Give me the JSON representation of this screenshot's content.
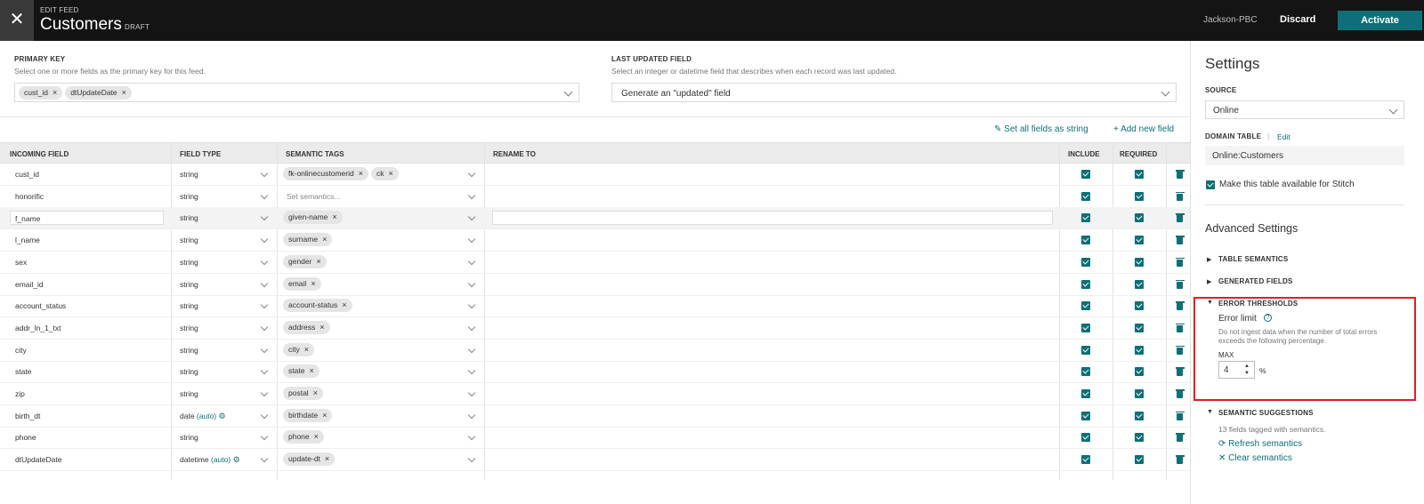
{
  "header": {
    "kicker": "EDIT FEED",
    "title": "Customers",
    "status": "DRAFT",
    "org": "Jackson-PBC",
    "discard_label": "Discard",
    "activate_label": "Activate",
    "close_glyph": "✕"
  },
  "primary_key": {
    "label": "PRIMARY KEY",
    "help": "Select one or more fields as the primary key for this feed.",
    "tags": [
      "cust_id",
      "dtUpdateDate"
    ]
  },
  "last_updated": {
    "label": "LAST UPDATED FIELD",
    "help": "Select an integer or datetime field that describes when each record was last updated.",
    "value": "Generate an \"updated\" field"
  },
  "toolbar": {
    "set_all_string": "Set all fields as string",
    "add_new_field": "Add new field",
    "pencil_icon": "✎",
    "plus_icon": "+"
  },
  "table": {
    "columns": [
      "INCOMING FIELD",
      "FIELD TYPE",
      "SEMANTIC TAGS",
      "RENAME TO",
      "INCLUDE",
      "REQUIRED"
    ],
    "set_semantics_placeholder": "Set semantics...",
    "auto_label": "(auto)",
    "rows": [
      {
        "field": "cust_id",
        "type": "string",
        "tags": [
          "fk-onlinecustomerid",
          "ck"
        ]
      },
      {
        "field": "honorific",
        "type": "string",
        "tags": []
      },
      {
        "field": "f_name",
        "type": "string",
        "tags": [
          "given-name"
        ]
      },
      {
        "field": "l_name",
        "type": "string",
        "tags": [
          "surname"
        ]
      },
      {
        "field": "sex",
        "type": "string",
        "tags": [
          "gender"
        ]
      },
      {
        "field": "email_id",
        "type": "string",
        "tags": [
          "email"
        ]
      },
      {
        "field": "account_status",
        "type": "string",
        "tags": [
          "account-status"
        ]
      },
      {
        "field": "addr_ln_1_txt",
        "type": "string",
        "tags": [
          "address"
        ]
      },
      {
        "field": "city",
        "type": "string",
        "tags": [
          "city"
        ]
      },
      {
        "field": "state",
        "type": "string",
        "tags": [
          "state"
        ]
      },
      {
        "field": "zip",
        "type": "string",
        "tags": [
          "postal"
        ]
      },
      {
        "field": "birth_dt",
        "type": "date",
        "auto": true,
        "tags": [
          "birthdate"
        ]
      },
      {
        "field": "phone",
        "type": "string",
        "tags": [
          "phone"
        ]
      },
      {
        "field": "dtUpdateDate",
        "type": "datetime",
        "auto": true,
        "tags": [
          "update-dt"
        ]
      }
    ]
  },
  "settings": {
    "title": "Settings",
    "source_label": "SOURCE",
    "source_value": "Online",
    "domain_label": "DOMAIN TABLE",
    "domain_edit": "Edit",
    "domain_value": "Online:Customers",
    "stitch_label": "Make this table available for Stitch",
    "advanced_title": "Advanced Settings",
    "table_semantics": "TABLE SEMANTICS",
    "generated_fields": "GENERATED FIELDS",
    "error_thresholds": "ERROR THRESHOLDS",
    "error_limit": "Error limit",
    "error_help": "Do not ingest data when the number of total errors exceeds the following percentage.",
    "max_label": "MAX",
    "max_value": "4",
    "percent": "%",
    "semantic_suggestions": "SEMANTIC SUGGESTIONS",
    "tagged_count": "13 fields tagged with semantics.",
    "refresh": "Refresh semantics",
    "clear": "Clear semantics"
  },
  "colors": {
    "accent": "#0e6f78",
    "topbar": "#141414",
    "highlight": "#e0201f"
  }
}
